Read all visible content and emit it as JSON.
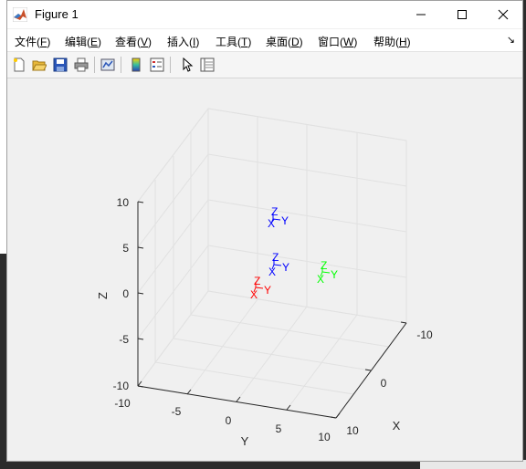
{
  "window": {
    "title": "Figure 1"
  },
  "menu": [
    {
      "label": "文件(F)",
      "hotkey": "F"
    },
    {
      "label": "编辑(E)",
      "hotkey": "E"
    },
    {
      "label": "查看(V)",
      "hotkey": "V"
    },
    {
      "label": "插入(I)",
      "hotkey": "I"
    },
    {
      "label": "工具(T)",
      "hotkey": "T"
    },
    {
      "label": "桌面(D)",
      "hotkey": "D"
    },
    {
      "label": "窗口(W)",
      "hotkey": "W"
    },
    {
      "label": "帮助(H)",
      "hotkey": "H"
    }
  ],
  "toolbar": [
    {
      "icon": "new-figure-icon"
    },
    {
      "icon": "open-file-icon"
    },
    {
      "icon": "save-icon"
    },
    {
      "icon": "print-icon"
    },
    {
      "icon": "link-plot-icon"
    },
    {
      "icon": "insert-colorbar-icon"
    },
    {
      "icon": "insert-legend-icon"
    },
    {
      "icon": "edit-plot-icon"
    },
    {
      "icon": "property-inspector-icon"
    }
  ],
  "axes": {
    "xlabel": "X",
    "ylabel": "Y",
    "zlabel": "Z",
    "x_ticks": [
      "-10",
      "0",
      "10"
    ],
    "y_ticks": [
      "-10",
      "-5",
      "0",
      "5",
      "10"
    ],
    "z_ticks": [
      "10",
      "5",
      "0",
      "-5",
      "-10"
    ],
    "xlim": [
      -10,
      10
    ],
    "ylim": [
      -10,
      10
    ],
    "zlim": [
      -10,
      10
    ],
    "grid": true
  },
  "colors": {
    "red": "#ff0000",
    "green": "#00ff00",
    "blue": "#0000ff"
  },
  "frames": [
    {
      "color": "red",
      "labels": [
        "X",
        "Y",
        "Z"
      ]
    },
    {
      "color": "green",
      "labels": [
        "X",
        "Y",
        "Z"
      ]
    },
    {
      "color": "blue",
      "labels": [
        "X",
        "Y",
        "Z"
      ]
    },
    {
      "color": "blue",
      "labels": [
        "X",
        "Y",
        "Z"
      ]
    }
  ]
}
